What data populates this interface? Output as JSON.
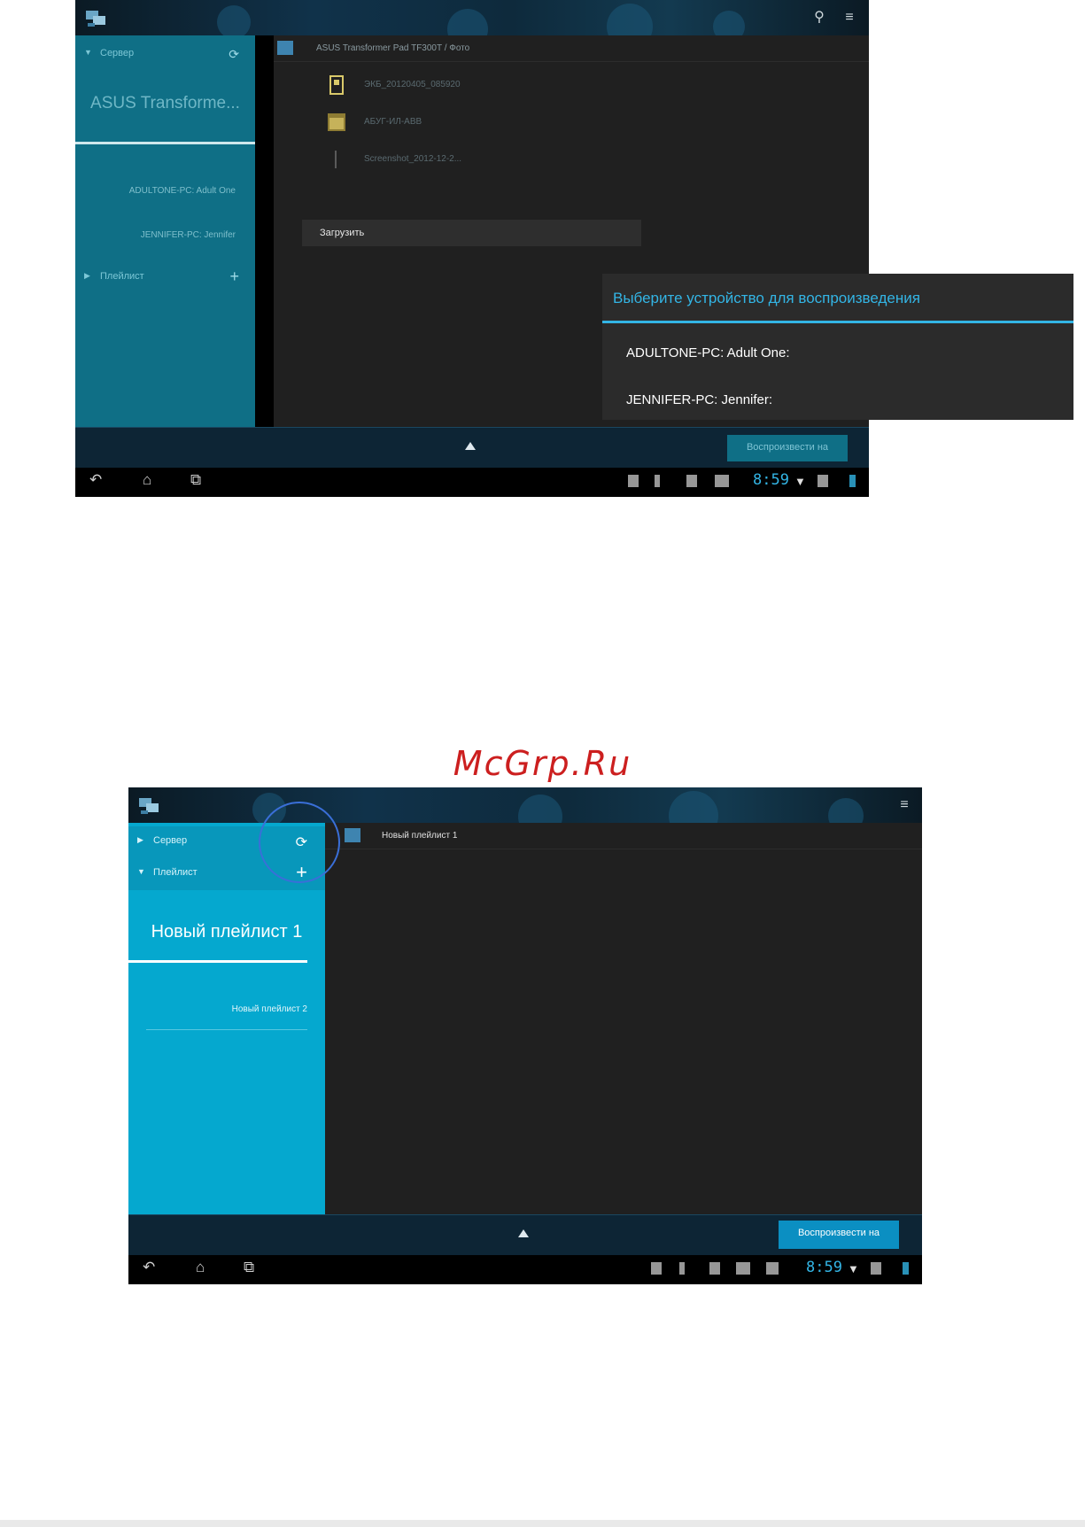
{
  "watermark": "McGrp.Ru",
  "screen1": {
    "sidebar": {
      "server_label": "Сервер",
      "title": "ASUS Transforme...",
      "devices": [
        "ADULTONE-PC: Adult One",
        "JENNIFER-PC: Jennifer"
      ],
      "playlist_label": "Плейлист"
    },
    "main": {
      "breadcrumb": "ASUS Transformer Pad TF300T / Фото",
      "files": [
        "ЭКБ_20120405_085920",
        "АБУГ-ИЛ-АВВ",
        "Screenshot_2012-12-2..."
      ],
      "context_menu_item": "Загрузить"
    },
    "dialog": {
      "title": "Выберите устройство для воспроизведения",
      "options": [
        "ADULTONE-PC: Adult One:",
        "JENNIFER-PC: Jennifer:"
      ]
    },
    "play_button": "Воспроизвести на",
    "clock": "8:59"
  },
  "screen2": {
    "sidebar": {
      "server_label": "Сервер",
      "playlist_label": "Плейлист",
      "title": "Новый плейлист 1",
      "items": [
        "Новый плейлист 2"
      ]
    },
    "main": {
      "breadcrumb": "Новый плейлист 1"
    },
    "play_button": "Воспроизвести на",
    "clock": "8:59"
  },
  "colors": {
    "accent": "#33b5e5",
    "sidebar_bright": "#05a8cf",
    "sidebar_dim": "#0f6f86",
    "highlight_circle": "#3a6fd8"
  }
}
